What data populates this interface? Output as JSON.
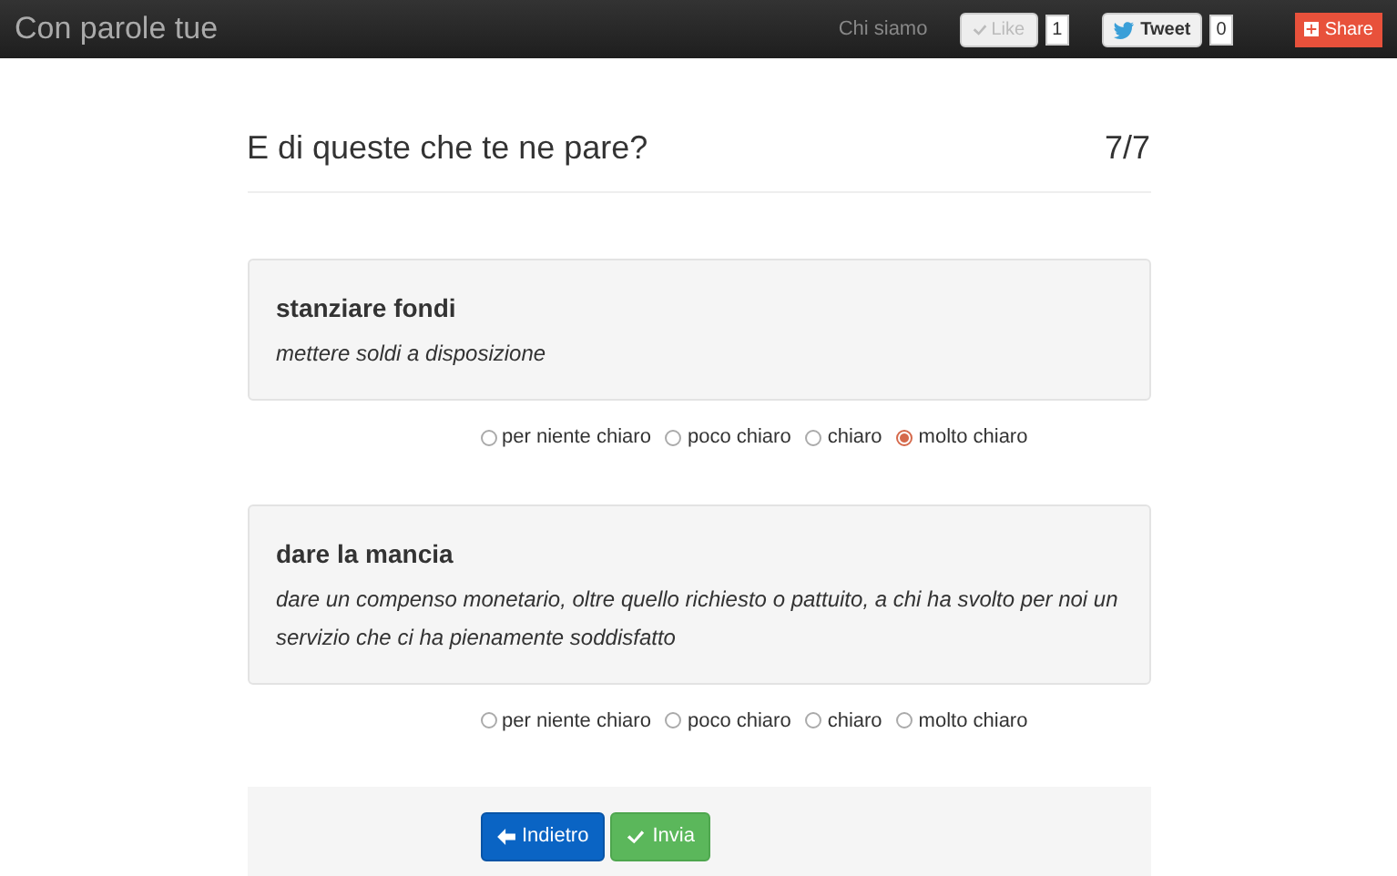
{
  "navbar": {
    "brand": "Con parole tue",
    "link": "Chi siamo",
    "like": {
      "label": "Like",
      "count": "1",
      "disabled": true
    },
    "tweet": {
      "label": "Tweet",
      "count": "0"
    },
    "share": {
      "label": "Share"
    }
  },
  "header": {
    "title": "E di queste che te ne pare?",
    "progress": "7/7"
  },
  "questions": [
    {
      "term": "stanziare fondi",
      "definition": "mettere soldi a disposizione",
      "options": [
        {
          "label": "per niente chiaro",
          "selected": false
        },
        {
          "label": "poco chiaro",
          "selected": false
        },
        {
          "label": "chiaro",
          "selected": false
        },
        {
          "label": "molto chiaro",
          "selected": true
        }
      ]
    },
    {
      "term": "dare la mancia",
      "definition": "dare un compenso monetario, oltre quello richiesto o pattuito, a chi ha svolto per noi un servizio che ci ha pienamente soddisfatto",
      "options": [
        {
          "label": "per niente chiaro",
          "selected": false
        },
        {
          "label": "poco chiaro",
          "selected": false
        },
        {
          "label": "chiaro",
          "selected": false
        },
        {
          "label": "molto chiaro",
          "selected": false
        }
      ]
    }
  ],
  "buttons": [
    {
      "kind": "back",
      "label": "Indietro"
    },
    {
      "kind": "submit",
      "label": "Invia"
    }
  ]
}
